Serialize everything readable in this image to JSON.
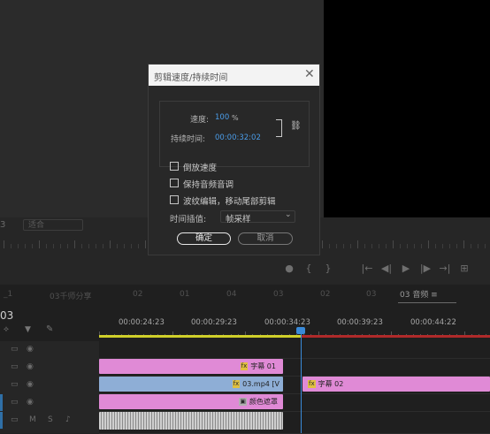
{
  "monitor": {
    "fit_label": "3",
    "fit_value": "适合",
    "transport": [
      "●",
      "{",
      "}",
      "|←",
      "◀|",
      "▶",
      "|▶",
      "→|",
      "⊞"
    ]
  },
  "dialog": {
    "title": "剪辑速度/持续时间",
    "close": "✕",
    "speed_label": "速度:",
    "speed_value": "100",
    "speed_unit": "%",
    "duration_label": "持续时间:",
    "duration_value": "00:00:32:02",
    "link_icon": "link-icon",
    "checkboxes": [
      {
        "label": "倒放速度",
        "checked": false
      },
      {
        "label": "保持音频音调",
        "checked": false
      },
      {
        "label": "波纹编辑，移动尾部剪辑",
        "checked": false
      }
    ],
    "interp_label": "时间插值:",
    "interp_value": "帧采样",
    "ok": "确定",
    "cancel": "取消"
  },
  "timeline": {
    "tabs": [
      "_1",
      "03千师分享",
      "02",
      "01",
      "04",
      "03",
      "02",
      "03"
    ],
    "seq_tab": "03 音频 ≡",
    "timecode": "03",
    "ruler": [
      "00:00:24:23",
      "00:00:29:23",
      "00:00:34:23",
      "00:00:39:23",
      "00:00:44:22"
    ],
    "clips": {
      "v4": "字幕 01",
      "v3_a": "03.mp4 [V",
      "v3_b": "字幕 02",
      "v2": "颜色遮罩"
    }
  },
  "colors": {
    "accent_blue": "#4a9ce8",
    "clip_pink": "#e08ad6",
    "clip_blue": "#8eaed6"
  }
}
